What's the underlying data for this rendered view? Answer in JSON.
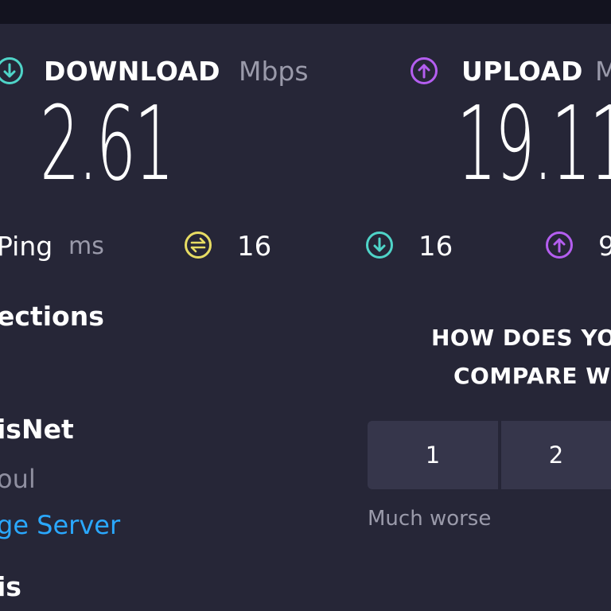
{
  "colors": {
    "background": "#262637",
    "topbar": "#13131f",
    "download": "#4fd4c8",
    "upload": "#b45ef0",
    "ping": "#e7dc63",
    "link": "#2aa8ff",
    "muted": "#9a9aaa"
  },
  "download": {
    "label": "DOWNLOAD",
    "unit": "Mbps",
    "value": "2.61",
    "icon": "arrow-down-circle-icon"
  },
  "upload": {
    "label": "UPLOAD",
    "unit": "M",
    "value": "19.11",
    "icon": "arrow-up-circle-icon"
  },
  "ping": {
    "label": "Ping",
    "unit": "ms",
    "idle": "16",
    "download": "16",
    "upload": "9"
  },
  "side": {
    "connections": "ections",
    "isp": "isNet",
    "location": "oul",
    "change_server": "ge Server",
    "host": "is"
  },
  "compare": {
    "line1": "HOW DOES YO",
    "line2": "COMPARE W",
    "options": [
      "1",
      "2"
    ],
    "low_caption": "Much worse"
  }
}
